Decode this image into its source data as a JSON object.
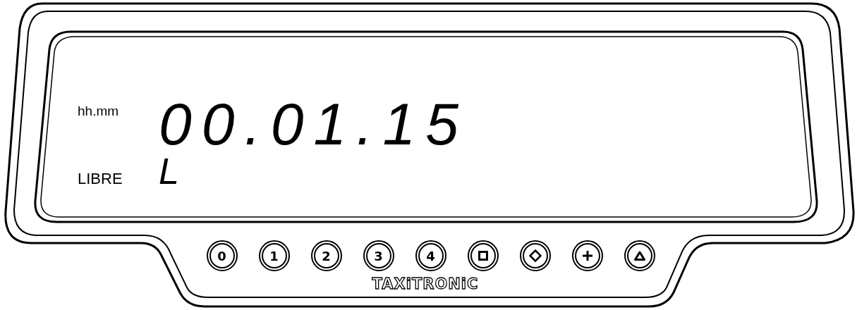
{
  "display": {
    "time_label": "hh.mm",
    "time": "00.01.15",
    "status_label": "LIBRE",
    "status_code": "L"
  },
  "buttons": [
    {
      "kind": "digit",
      "label": "0"
    },
    {
      "kind": "digit",
      "label": "1"
    },
    {
      "kind": "digit",
      "label": "2"
    },
    {
      "kind": "digit",
      "label": "3"
    },
    {
      "kind": "digit",
      "label": "4"
    },
    {
      "kind": "square"
    },
    {
      "kind": "diamond"
    },
    {
      "kind": "plus"
    },
    {
      "kind": "triangle"
    }
  ],
  "brand": "TAXiTRONiC"
}
